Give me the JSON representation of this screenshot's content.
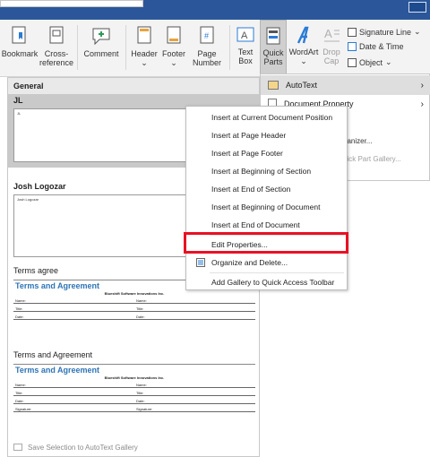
{
  "ribbon": {
    "buttons": {
      "bookmark": "Bookmark",
      "cross_ref_1": "Cross-",
      "cross_ref_2": "reference",
      "comment": "Comment",
      "header": "Header",
      "footer": "Footer",
      "page_number_1": "Page",
      "page_number_2": "Number",
      "text_box_1": "Text",
      "text_box_2": "Box",
      "quick_parts_1": "Quick",
      "quick_parts_2": "Parts",
      "wordart": "WordArt",
      "drop_cap_1": "Drop",
      "drop_cap_2": "Cap",
      "signature_line": "Signature Line",
      "date_time": "Date & Time",
      "object": "Object"
    }
  },
  "quick_parts_menu": {
    "autotext": "AutoText",
    "document_property": "Document Property",
    "organizer_fragment": "ganizer...",
    "gallery_fragment": "uick Part Gallery..."
  },
  "gallery": {
    "header": "General",
    "entries": [
      {
        "name": "JL",
        "preview": "JL"
      },
      {
        "name": "Josh Logozar",
        "preview": "Josh Logozar"
      },
      {
        "name": "Terms agree"
      },
      {
        "name": "Terms and Agreement"
      }
    ],
    "form": {
      "title": "Terms and Agreement",
      "company": "Blueshift Software Innovations Inc.",
      "rows": [
        [
          "Name:",
          "Name:"
        ],
        [
          "Title:",
          "Title:"
        ],
        [
          "Date:",
          "Date:"
        ]
      ],
      "extra_row": [
        "Signature:",
        "Signature:"
      ]
    },
    "footer": "Save Selection to AutoText Gallery"
  },
  "context_menu": {
    "items": [
      "Insert at Current Document Position",
      "Insert at Page Header",
      "Insert at Page Footer",
      "Insert at Beginning of Section",
      "Insert at End of Section",
      "Insert at Beginning of Document",
      "Insert at End of Document",
      "Edit Properties...",
      "Organize and Delete...",
      "Add Gallery to Quick Access Toolbar"
    ],
    "highlight_color": "#e81123"
  }
}
